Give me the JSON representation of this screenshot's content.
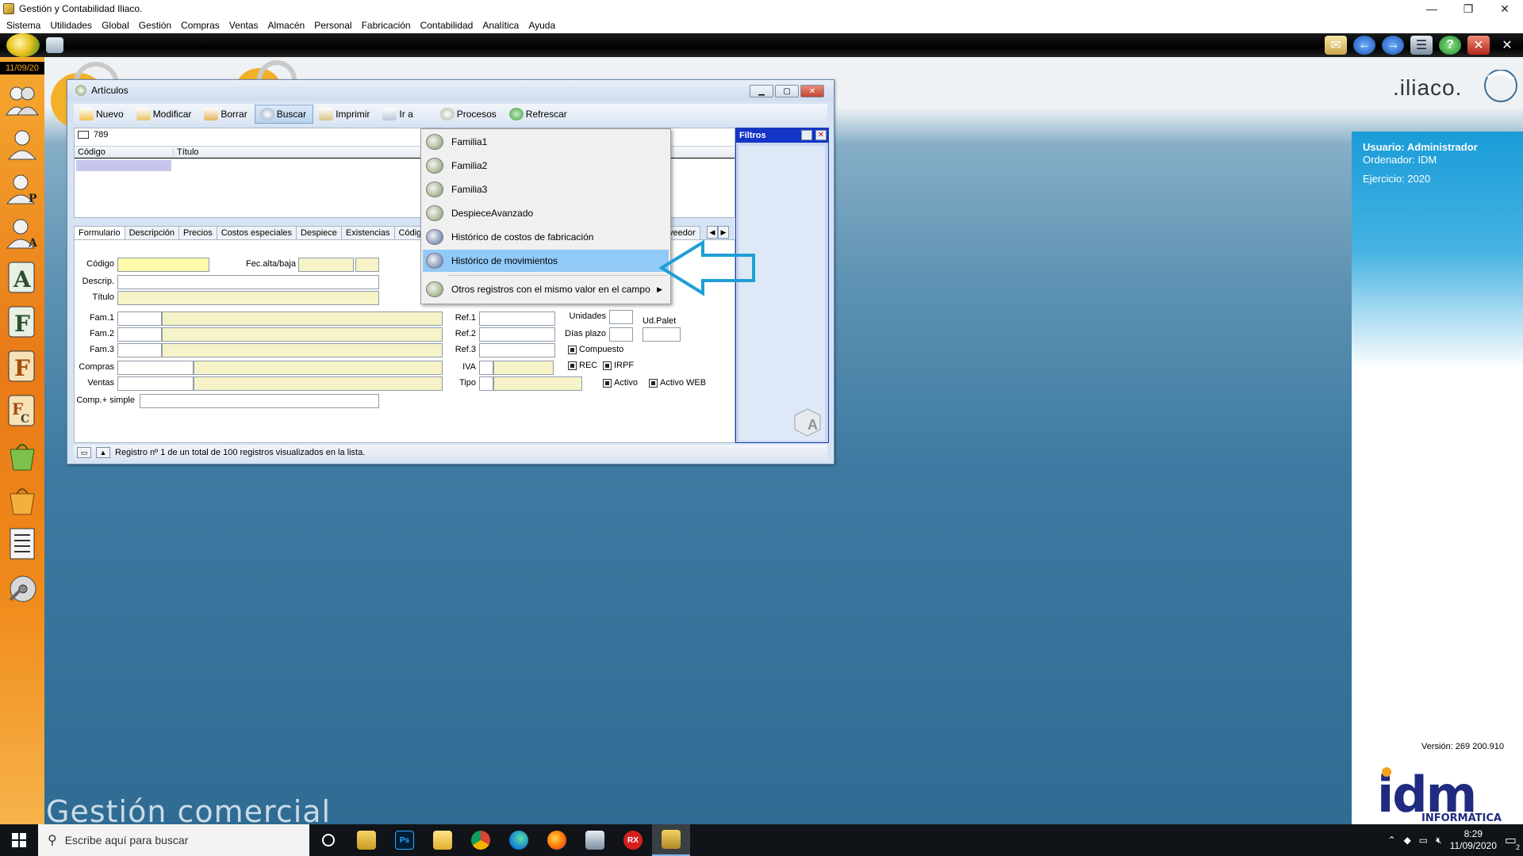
{
  "window_title": "Gestión y Contabilidad Iliaco.",
  "menu": [
    "Sistema",
    "Utilidades",
    "Global",
    "Gestión",
    "Compras",
    "Ventas",
    "Almacén",
    "Personal",
    "Fabricación",
    "Contabilidad",
    "Analítica",
    "Ayuda"
  ],
  "sidebar": {
    "date": "11/09/20"
  },
  "desktop": {
    "section_label": "Gestión comercial"
  },
  "right_panel": {
    "user": "Usuario: Administrador",
    "computer": "Ordenador: IDM",
    "year": "Ejercicio: 2020",
    "version": "Versión: 269 200.910",
    "brand": ".iliaco.",
    "idm_logo": "idm",
    "idm_sub": "INFORMÁTICA"
  },
  "articulos": {
    "title": "Artículos",
    "toolbar": [
      "Nuevo",
      "Modificar",
      "Borrar",
      "Buscar",
      "Imprimir",
      "Ir a",
      "Procesos",
      "Refrescar"
    ],
    "record_count": "789",
    "columns": [
      "Código",
      "Título"
    ],
    "filters_title": "Filtros",
    "tabs": [
      "Formulario",
      "Descripción",
      "Precios",
      "Costos especiales",
      "Despiece",
      "Existencias",
      "Código",
      "veedor"
    ],
    "form_labels": {
      "codigo": "Código",
      "fec_alta": "Fec.alta/baja",
      "descrip": "Descrip.",
      "titulo": "Título",
      "fam1": "Fam.1",
      "fam2": "Fam.2",
      "fam3": "Fam.3",
      "ref1": "Ref.1",
      "ref2": "Ref.2",
      "ref3": "Ref.3",
      "unidades": "Unidades",
      "dias_plazo": "Días plazo",
      "ud_palet": "Ud.Palet",
      "compras": "Compras",
      "ventas": "Ventas",
      "iva": "IVA",
      "tipo": "Tipo",
      "comp_simple": "Comp.+ simple"
    },
    "checkboxes": {
      "compuesto": "Compuesto",
      "rec": "REC",
      "irpf": "IRPF",
      "activo": "Activo",
      "activo_web": "Activo WEB"
    },
    "status_text": "Registro nº 1 de un total de 100 registros visualizados en la lista."
  },
  "context_menu": {
    "items": [
      "Familia1",
      "Familia2",
      "Familia3",
      "DespieceAvanzado",
      "Histórico de costos de fabricación",
      "Histórico de movimientos",
      "Otros registros con el mismo valor en el campo"
    ],
    "highlighted_index": 5
  },
  "taskbar": {
    "search_placeholder": "Escribe aquí para buscar",
    "time": "8:29",
    "date": "11/09/2020",
    "notif_count": "2"
  },
  "colors": {
    "accent_blue": "#1a9cd8",
    "sidebar_orange": "#e87a18",
    "menu_highlight": "#91c9f7",
    "arrow_blue": "#1e9fd6"
  }
}
